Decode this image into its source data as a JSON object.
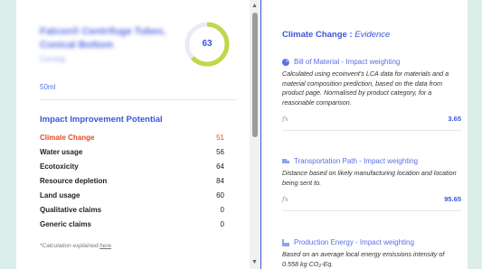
{
  "colors": {
    "accent": "#3b55d9",
    "active": "#e04a2a",
    "ring": "#c3d64a"
  },
  "product": {
    "name": "Falcon® Centrifuge Tubes, Conical Bottom",
    "brand": "Corning",
    "size": "50ml",
    "score": "63",
    "score_fraction": 0.63
  },
  "impact": {
    "title": "Impact Improvement Potential",
    "items": [
      {
        "label": "Climate Change",
        "value": "51",
        "active": true
      },
      {
        "label": "Water usage",
        "value": "56"
      },
      {
        "label": "Ecotoxicity",
        "value": "64"
      },
      {
        "label": "Resource depletion",
        "value": "84"
      },
      {
        "label": "Land usage",
        "value": "60"
      },
      {
        "label": "Qualitative claims",
        "value": "0"
      },
      {
        "label": "Generic claims",
        "value": "0"
      }
    ],
    "note_prefix": "*Calculation explained ",
    "note_link": "here"
  },
  "evidence": {
    "title_main": "Climate Change : ",
    "title_sub": "Evidence",
    "sections": [
      {
        "icon": "pie-chart-icon",
        "heading": "Bill of Material - Impact weighting",
        "body": "Calculated using ecoinvent's LCA data for materials and a material composition prediction, based on the data from product page. Normalised by product category, for a reasonable comparison.",
        "fx": "fx",
        "value": "3.65"
      },
      {
        "icon": "truck-icon",
        "heading": "Transportation Path - Impact weighting",
        "body": "Distance based on likely manufacturing location and location being sent to.",
        "fx": "fx",
        "value": "95.65"
      },
      {
        "icon": "factory-icon",
        "heading": "Production Energy - Impact weighting",
        "body": "Based on an average local energy emissions intensity of 0.558 kg CO₂-Eq."
      }
    ]
  }
}
